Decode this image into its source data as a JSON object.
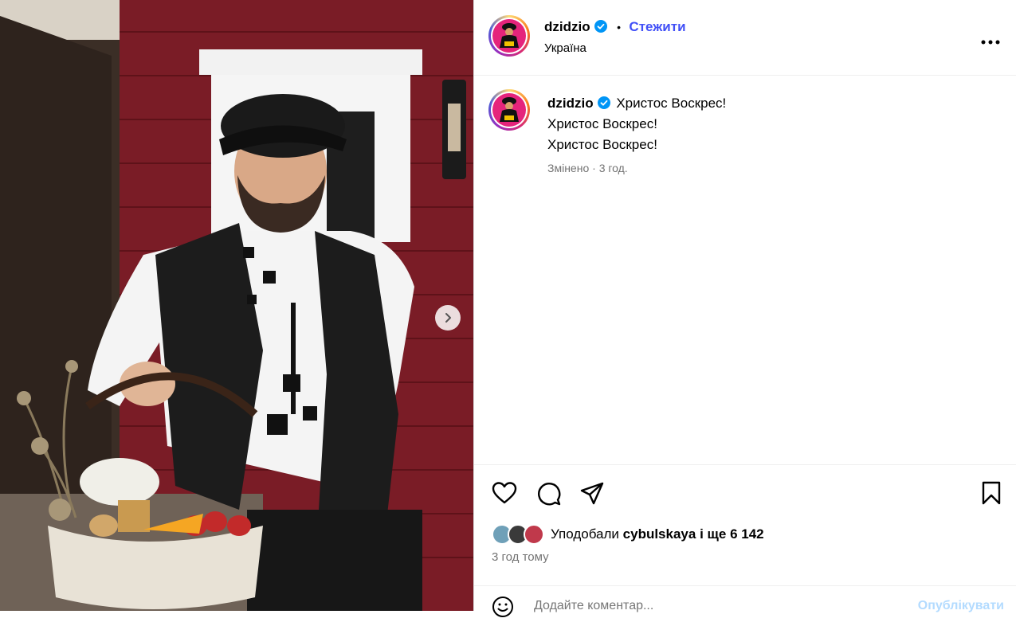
{
  "post": {
    "author": "dzidzio",
    "follow_label": "Стежити",
    "separator": "•",
    "location": "Україна",
    "more_label": "•••"
  },
  "caption": {
    "author": "dzidzio",
    "lines": [
      "Христос Воскрес!",
      "Христос Воскрес!",
      "Христос Воскрес!"
    ],
    "edited": "Змінено",
    "dot": "·",
    "time": "3 год."
  },
  "likes": {
    "prefix": "Уподобали",
    "user": "cybulskaya",
    "middle": "і ще",
    "count": "6 142"
  },
  "time_ago": "3 год тому",
  "comment": {
    "placeholder": "Додайте коментар...",
    "publish_label": "Опублікувати"
  },
  "colors": {
    "accent": "#4150f7",
    "verified": "#0095f6",
    "muted": "#737373"
  },
  "icons": {
    "like": "heart-icon",
    "comment": "comment-icon",
    "share": "share-icon",
    "save": "bookmark-icon",
    "next": "chevron-right-icon",
    "emoji": "emoji-icon"
  }
}
